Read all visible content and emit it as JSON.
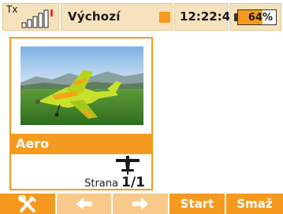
{
  "status_bar": {
    "tx_label": "Tx",
    "signal_bars": 3,
    "model_name": "Výchozí",
    "time": "12:22:42",
    "battery_text": "64%",
    "battery_level": 0.64
  },
  "model_card": {
    "name": "Aero",
    "page_prefix": "Strana",
    "page_value": "1/1",
    "icon": "airplane-icon",
    "photo": "model-airplane-photo"
  },
  "footer": {
    "keys": [
      {
        "icon": "wrench-screwdriver-icon",
        "label": ""
      },
      {
        "icon": "arrow-left-icon",
        "label": ""
      },
      {
        "icon": "arrow-right-icon",
        "label": ""
      },
      {
        "icon": "",
        "label": "Start"
      },
      {
        "icon": "",
        "label": "Smaž"
      }
    ]
  },
  "colors": {
    "accent": "#f59a1e",
    "accent_light": "#f8c98a",
    "status_bg": "#f6e2bd"
  }
}
